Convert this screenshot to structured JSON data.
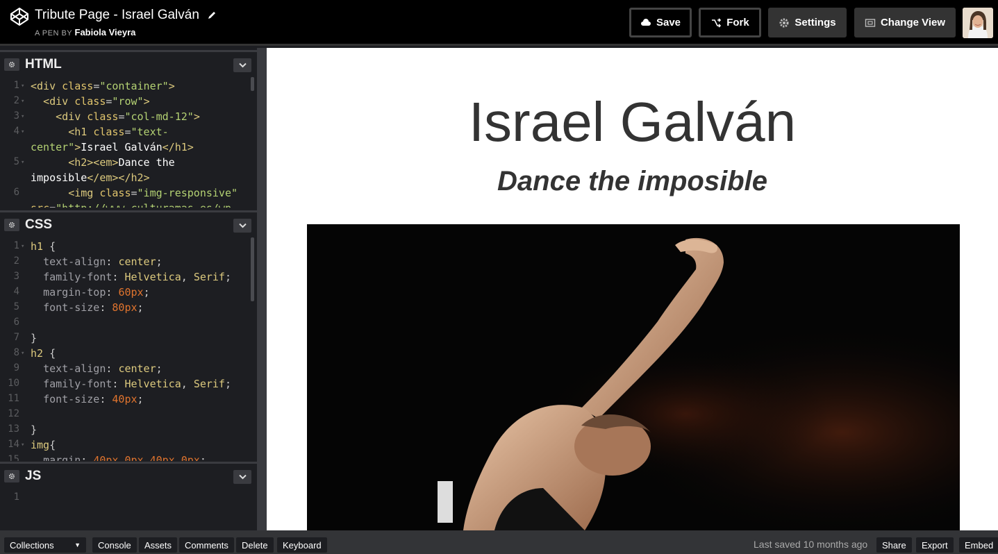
{
  "header": {
    "pen_title": "Tribute Page - Israel Galván",
    "by_label": "A PEN BY",
    "author": "Fabiola Vieyra",
    "save_label": "Save",
    "fork_label": "Fork",
    "settings_label": "Settings",
    "change_view_label": "Change View"
  },
  "panes": {
    "html": {
      "title": "HTML",
      "line_numbers": [
        "1",
        "2",
        "3",
        "4",
        "",
        "5",
        "",
        "6",
        ""
      ]
    },
    "css": {
      "title": "CSS",
      "line_numbers": [
        "1",
        "2",
        "3",
        "4",
        "5",
        "6",
        "7",
        "8",
        "9",
        "10",
        "11",
        "12",
        "13",
        "14",
        "15"
      ]
    },
    "js": {
      "title": "JS",
      "line_numbers": [
        "1"
      ]
    }
  },
  "preview": {
    "heading": "Israel Galván",
    "subheading": "Dance the imposible"
  },
  "footer": {
    "collections_label": "Collections",
    "console_label": "Console",
    "assets_label": "Assets",
    "comments_label": "Comments",
    "delete_label": "Delete",
    "keyboard_label": "Keyboard",
    "last_saved": "Last saved 10 months ago",
    "share_label": "Share",
    "export_label": "Export",
    "embed_label": "Embed"
  },
  "icons": {
    "logo": "codepen-logo-icon",
    "pencil": "pencil-icon",
    "save": "cloud-icon",
    "fork": "fork-icon",
    "settings": "gear-icon",
    "change_view": "layout-icon"
  }
}
